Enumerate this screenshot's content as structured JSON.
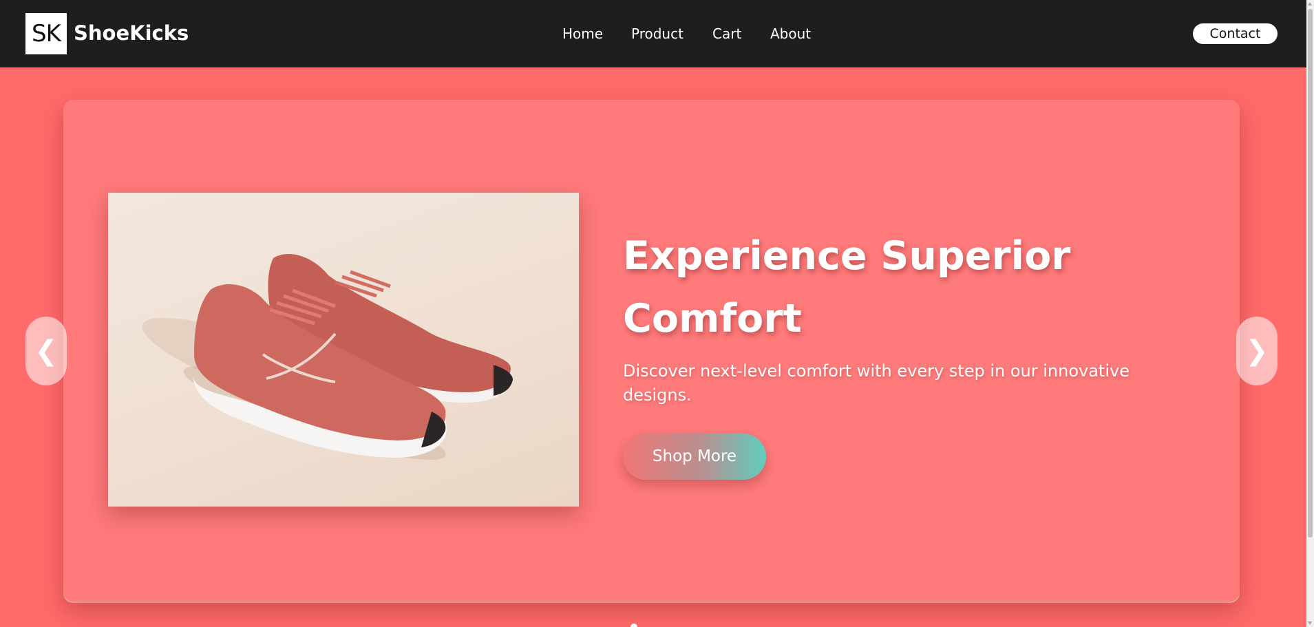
{
  "navbar": {
    "logo_text": "SK",
    "brand": "ShoeKicks",
    "links": [
      {
        "label": "Home"
      },
      {
        "label": "Product"
      },
      {
        "label": "Cart"
      },
      {
        "label": "About"
      }
    ],
    "contact_label": "Contact"
  },
  "hero": {
    "title": "Experience Superior Comfort",
    "subtitle": "Discover next-level comfort with every step in our innovative designs.",
    "cta_label": "Shop More",
    "image_icon": "running-shoes-photo"
  },
  "carousel": {
    "prev_label": "❮",
    "next_label": "❯",
    "prev_icon": "chevron-left-icon",
    "next_icon": "chevron-right-icon"
  },
  "colors": {
    "background": "#ff6b6b",
    "navbar": "#1e1e1e",
    "card": "#ff7a7a",
    "button_gradient_start": "#f07676",
    "button_gradient_end": "#5fcdbf",
    "shoe": "#c9655a"
  }
}
